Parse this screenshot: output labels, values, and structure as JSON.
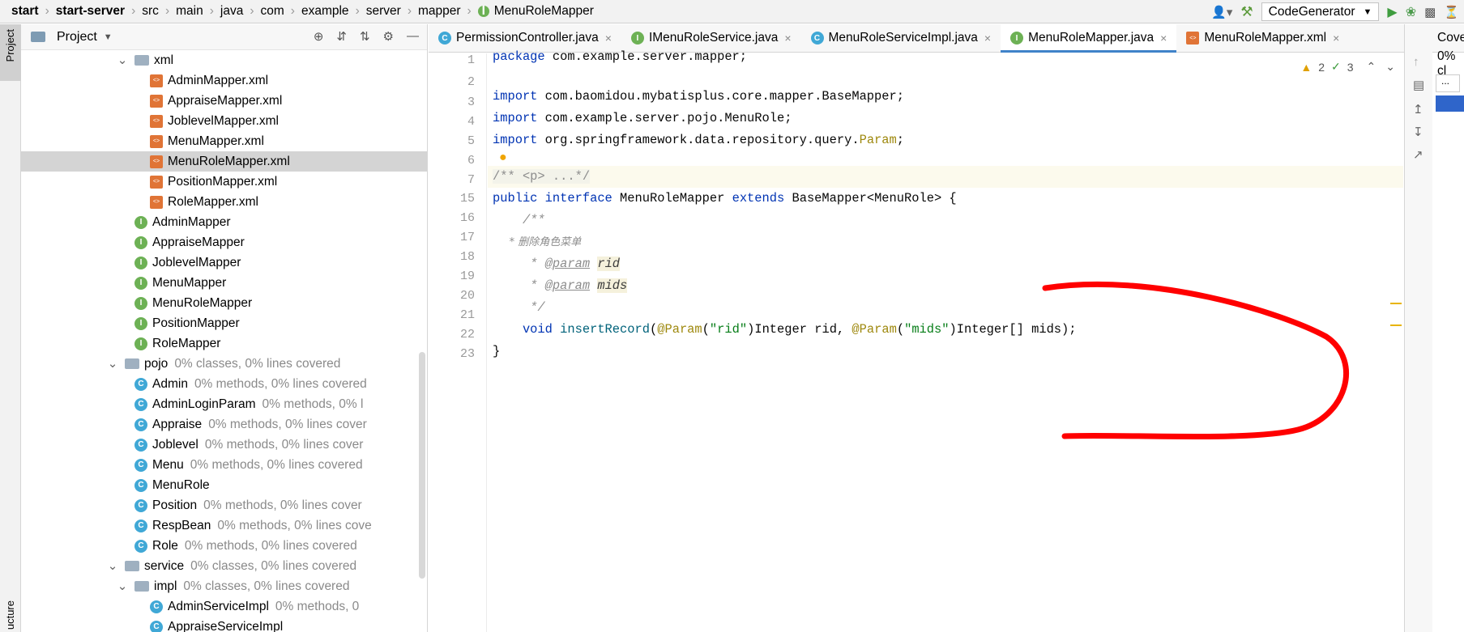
{
  "breadcrumb": {
    "items": [
      "start",
      "start-server",
      "src",
      "main",
      "java",
      "com",
      "example",
      "server",
      "mapper",
      "MenuRoleMapper"
    ]
  },
  "toolbar": {
    "run_config": "CodeGenerator"
  },
  "side_strip": {
    "project_label": "Project",
    "structure_label": "ucture"
  },
  "project_panel": {
    "title": "Project"
  },
  "tree": [
    {
      "label": "xml",
      "cov": "",
      "icon": "folder",
      "depth": 2,
      "arrow": "v"
    },
    {
      "label": "AdminMapper.xml",
      "cov": "",
      "icon": "xml",
      "depth": 3
    },
    {
      "label": "AppraiseMapper.xml",
      "cov": "",
      "icon": "xml",
      "depth": 3
    },
    {
      "label": "JoblevelMapper.xml",
      "cov": "",
      "icon": "xml",
      "depth": 3
    },
    {
      "label": "MenuMapper.xml",
      "cov": "",
      "icon": "xml",
      "depth": 3
    },
    {
      "label": "MenuRoleMapper.xml",
      "cov": "",
      "icon": "xml",
      "depth": 3,
      "selected": true
    },
    {
      "label": "PositionMapper.xml",
      "cov": "",
      "icon": "xml",
      "depth": 3
    },
    {
      "label": "RoleMapper.xml",
      "cov": "",
      "icon": "xml",
      "depth": 3
    },
    {
      "label": "AdminMapper",
      "cov": "",
      "icon": "interface",
      "depth": 2
    },
    {
      "label": "AppraiseMapper",
      "cov": "",
      "icon": "interface",
      "depth": 2
    },
    {
      "label": "JoblevelMapper",
      "cov": "",
      "icon": "interface",
      "depth": 2
    },
    {
      "label": "MenuMapper",
      "cov": "",
      "icon": "interface",
      "depth": 2
    },
    {
      "label": "MenuRoleMapper",
      "cov": "",
      "icon": "interface",
      "depth": 2
    },
    {
      "label": "PositionMapper",
      "cov": "",
      "icon": "interface",
      "depth": 2
    },
    {
      "label": "RoleMapper",
      "cov": "",
      "icon": "interface",
      "depth": 2
    },
    {
      "label": "pojo",
      "cov": "0% classes, 0% lines covered",
      "icon": "folder",
      "depth": 1,
      "arrow": "v"
    },
    {
      "label": "Admin",
      "cov": "0% methods, 0% lines covered",
      "icon": "class",
      "depth": 2
    },
    {
      "label": "AdminLoginParam",
      "cov": "0% methods, 0% l",
      "icon": "class",
      "depth": 2
    },
    {
      "label": "Appraise",
      "cov": "0% methods, 0% lines cover",
      "icon": "class",
      "depth": 2
    },
    {
      "label": "Joblevel",
      "cov": "0% methods, 0% lines cover",
      "icon": "class",
      "depth": 2
    },
    {
      "label": "Menu",
      "cov": "0% methods, 0% lines covered",
      "icon": "class",
      "depth": 2
    },
    {
      "label": "MenuRole",
      "cov": "",
      "icon": "class",
      "depth": 2
    },
    {
      "label": "Position",
      "cov": "0% methods, 0% lines cover",
      "icon": "class",
      "depth": 2
    },
    {
      "label": "RespBean",
      "cov": "0% methods, 0% lines cove",
      "icon": "class",
      "depth": 2
    },
    {
      "label": "Role",
      "cov": "0% methods, 0% lines covered",
      "icon": "class",
      "depth": 2
    },
    {
      "label": "service",
      "cov": "0% classes, 0% lines covered",
      "icon": "folder",
      "depth": 1,
      "arrow": "v"
    },
    {
      "label": "impl",
      "cov": "0% classes, 0% lines covered",
      "icon": "folder",
      "depth": 2,
      "arrow": "v"
    },
    {
      "label": "AdminServiceImpl",
      "cov": "0% methods, 0",
      "icon": "class",
      "depth": 3
    },
    {
      "label": "AppraiseServiceImpl",
      "cov": "",
      "icon": "class",
      "depth": 3
    }
  ],
  "tabs": [
    {
      "label": "PermissionController.java",
      "icon": "class",
      "active": false
    },
    {
      "label": "IMenuRoleService.java",
      "icon": "interface",
      "active": false
    },
    {
      "label": "MenuRoleServiceImpl.java",
      "icon": "class",
      "active": false
    },
    {
      "label": "MenuRoleMapper.java",
      "icon": "interface",
      "active": true
    },
    {
      "label": "MenuRoleMapper.xml",
      "icon": "xml",
      "active": false
    }
  ],
  "inspections": {
    "warnings": "2",
    "weak_warnings": "3"
  },
  "line_numbers": [
    "1",
    "2",
    "3",
    "4",
    "5",
    "6",
    "7",
    "15",
    "16",
    "17",
    "18",
    "19",
    "20",
    "21",
    "22",
    "23"
  ],
  "code": {
    "l1_kw": "package",
    "l1_rest": " com.example.server.mapper;",
    "l3_kw": "import",
    "l3_rest": " com.baomidou.mybatisplus.core.mapper.BaseMapper;",
    "l4_kw": "import",
    "l4_rest": " com.example.server.pojo.MenuRole;",
    "l5_kw": "import",
    "l5_rest": " org.springframework.data.repository.query.",
    "l5_an": "Param",
    "l5_end": ";",
    "l7_fold": "/** <p> ...*/",
    "l15_kw1": "public",
    "l15_kw2": "interface",
    "l15_name": " MenuRoleMapper ",
    "l15_kw3": "extends",
    "l15_rest": " BaseMapper<MenuRole> {",
    "l16": "    /**",
    "l17": "     * 删除角色菜单",
    "l18_star": "     * ",
    "l18_tag": "@param",
    "l18_name": "rid",
    "l19_star": "     * ",
    "l19_tag": "@param",
    "l19_name": "mids",
    "l20": "     */",
    "l21_kw": "    void",
    "l21_fn": "insertRecord",
    "l21_p1": "(",
    "l21_an1": "@Param",
    "l21_s1p": "(",
    "l21_str1": "\"rid\"",
    "l21_mid1": ")Integer rid, ",
    "l21_an2": "@Param",
    "l21_s2p": "(",
    "l21_str2": "\"mids\"",
    "l21_end": ")Integer[] mids);",
    "l22": "}"
  },
  "coverage_panel": {
    "title": "Coverage",
    "percent": "0% cl"
  },
  "colors": {
    "accent": "#4083c9",
    "annotation": "#ff0000"
  }
}
